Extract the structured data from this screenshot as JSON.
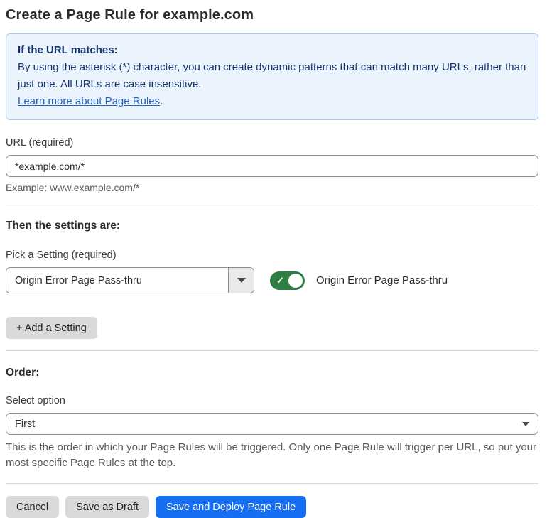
{
  "page": {
    "title": "Create a Page Rule for example.com"
  },
  "info_box": {
    "heading": "If the URL matches:",
    "body": "By using the asterisk (*) character, you can create dynamic patterns that can match many URLs, rather than just one. All URLs are case insensitive.",
    "link_label": "Learn more about Page Rules",
    "link_suffix": "."
  },
  "url_section": {
    "label": "URL (required)",
    "value": "*example.com/*",
    "example": "Example: www.example.com/*"
  },
  "settings_section": {
    "heading": "Then the settings are:",
    "picker_label": "Pick a Setting (required)",
    "selected_setting": "Origin Error Page Pass-thru",
    "toggle_state": "on",
    "toggle_label": "Origin Error Page Pass-thru",
    "add_setting_label": "+ Add a Setting"
  },
  "order_section": {
    "heading": "Order:",
    "select_label": "Select option",
    "selected_option": "First",
    "help_text": "This is the order in which your Page Rules will be triggered. Only one Page Rule will trigger per URL, so put your most specific Page Rules at the top."
  },
  "footer": {
    "cancel_label": "Cancel",
    "save_draft_label": "Save as Draft",
    "save_deploy_label": "Save and Deploy Page Rule"
  },
  "icons": {
    "toggle_check": "✓"
  },
  "colors": {
    "accent_blue": "#166ff2",
    "info_background": "#ebf3fc",
    "info_border": "#abc9ee",
    "info_text": "#16356e",
    "link_blue": "#2563c2",
    "toggle_green": "#2e7d44",
    "button_gray": "#d9d9d9"
  }
}
